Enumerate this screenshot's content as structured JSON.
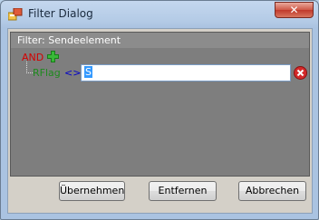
{
  "window": {
    "title": "Filter Dialog",
    "close_glyph": "✕"
  },
  "panel": {
    "header": "Filter: Sendeelement"
  },
  "tree": {
    "group_operator": "AND",
    "condition": {
      "field": "RFlag",
      "operator": "<>",
      "value": "S"
    }
  },
  "buttons": {
    "apply": "Übernehmen",
    "remove": "Entfernen",
    "cancel": "Abbrechen"
  },
  "icons": {
    "app": "filter-dialog-icon",
    "add": "plus-icon",
    "delete": "remove-icon"
  },
  "colors": {
    "and": "#d40000",
    "field": "#1e8a1e",
    "operator": "#0000c8",
    "selection": "#3399ff"
  }
}
